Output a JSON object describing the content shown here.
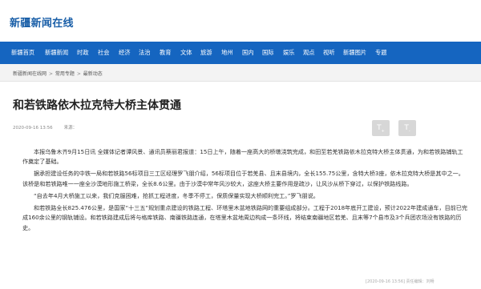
{
  "site": {
    "logo_text": "新疆新闻在线"
  },
  "nav": {
    "items": [
      "新疆首页",
      "新疆新闻",
      "时政",
      "社会",
      "经济",
      "法治",
      "教育",
      "文体",
      "旅游",
      "地州",
      "国内",
      "国际",
      "娱乐",
      "观点",
      "视听",
      "新疆图片",
      "专题"
    ]
  },
  "breadcrumb": {
    "items": [
      "新疆新闻在线网",
      "常用专题",
      "最新动态"
    ],
    "separator": ">"
  },
  "article": {
    "title": "和若铁路依木拉克特大桥主体贯通",
    "date": "2020-09-16 13:56",
    "source": "来源：",
    "paragraphs": [
      "本报乌鲁木齐9月15日讯 全媒体记者谭风景、通讯员蔡丽君报道：15日上午，随着一座高大的桥墩浇筑完成，和田至若羌铁路依木拉克特大桥主体贯通，为和若铁路铺轨工作奠定了基础。",
      "据承担建设任务的中铁一局和若铁路56标项目三工区经理罗飞朋介绍，56标项目位于若羌县、且末县境内，全长155.75公里，含特大桥3座，依木拉克特大桥是其中之一。该桥是和若铁路唯一一座全沙漠地形施工桥梁，全长8.6公里。由于沙漠中常年风沙较大，这座大桥主要作用是疏沙，让风沙从桥下穿过，以保护铁路线路。",
      "“自去年4月大桥施工以来，我们克服困难，抢抓工程进度，冬季不停工，保质保量实现大桥顺利完工。”罗飞朋说。",
      "和若铁路全长825.476公里，是国家“十三五”规划重点建设的铁路工程、环塔里木盆地铁路网的重要组成部分。工程于2018年底开工建设，预计2022年建成通车，目前已完成160余公里的钢轨铺设。和若铁路建成后将与格库铁路、南疆铁路连通，在塔里木盆地周边构成一条环线，将结束南疆地区若羌、且末等7个县市及3个兵团农场没有铁路的历史。"
    ]
  },
  "share": {
    "buttons": [
      "T",
      "T"
    ]
  },
  "footer": {
    "note": "[2020-09-16 13:56]  责任编辑：刘畅"
  }
}
